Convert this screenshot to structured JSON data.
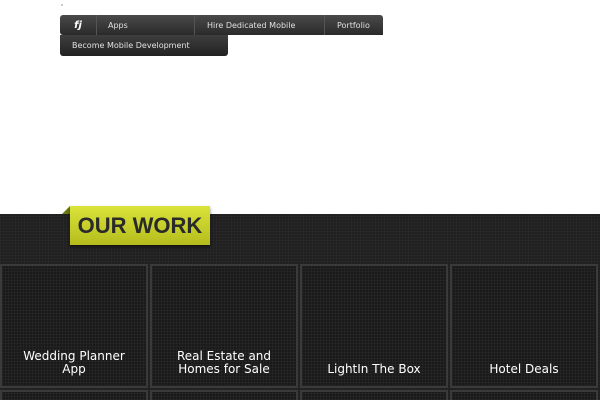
{
  "nav": {
    "home_icon": "fj",
    "items": [
      {
        "label": "Apps"
      },
      {
        "label": "Hire Dedicated Mobile"
      },
      {
        "label": "Portfolio"
      }
    ],
    "dropdown_item": "Become Mobile Development"
  },
  "section": {
    "title": "OUR WORK"
  },
  "projects": [
    {
      "title": "Wedding Planner App"
    },
    {
      "title": "Real Estate and Homes for Sale"
    },
    {
      "title": "LightIn The Box"
    },
    {
      "title": "Hotel Deals"
    }
  ],
  "colors": {
    "accent": "#c8d12a",
    "nav_bg": "#3a3a3a",
    "section_bg": "#202020"
  }
}
